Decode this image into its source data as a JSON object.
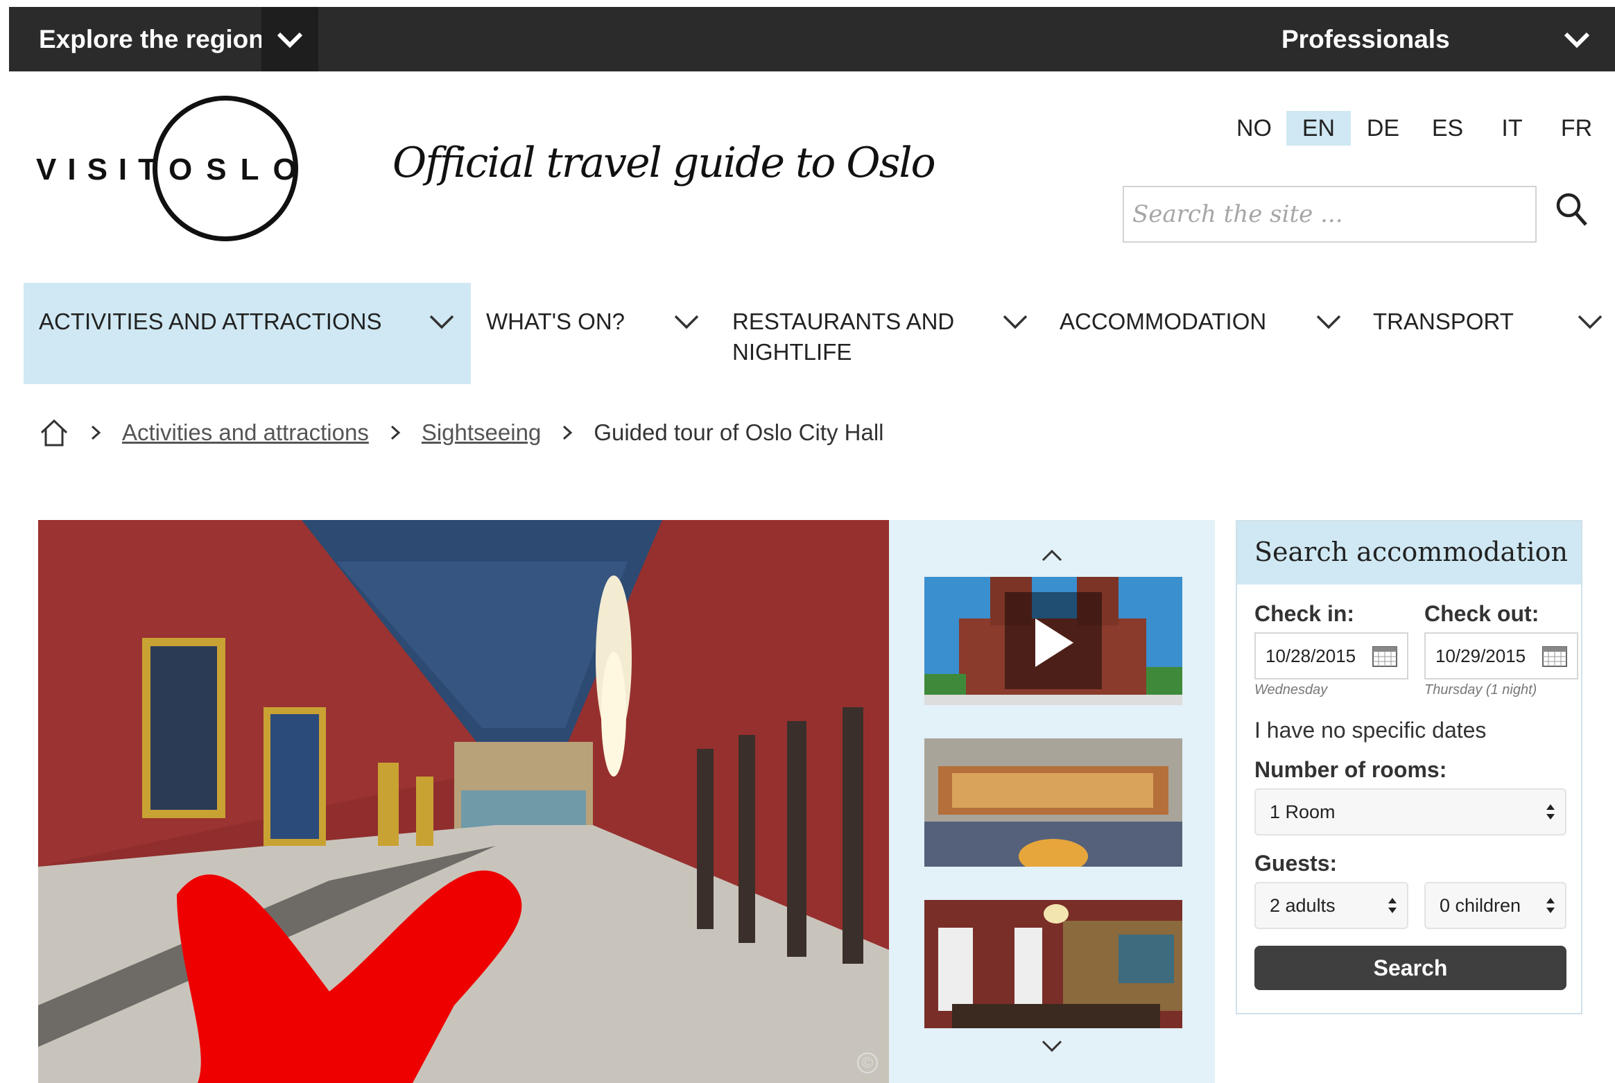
{
  "topbar": {
    "explore_label": "Explore the region",
    "professionals_label": "Professionals"
  },
  "header": {
    "logo_visit": "VISIT",
    "logo_oslo": "OSLO",
    "tagline": "Official travel guide to Oslo",
    "languages": [
      "NO",
      "EN",
      "DE",
      "ES",
      "IT",
      "FR"
    ],
    "active_language": "EN",
    "search_placeholder": "Search the site ..."
  },
  "nav": {
    "items": [
      {
        "label": "ACTIVITIES AND ATTRACTIONS",
        "active": true
      },
      {
        "label": "WHAT'S ON?",
        "active": false
      },
      {
        "label": "RESTAURANTS AND NIGHTLIFE",
        "active": false
      },
      {
        "label": "ACCOMMODATION",
        "active": false
      },
      {
        "label": "TRANSPORT",
        "active": false
      }
    ]
  },
  "breadcrumb": {
    "items": [
      "Activities and attractions",
      "Sightseeing"
    ],
    "current": "Guided tour of Oslo City Hall"
  },
  "gallery": {
    "copyright_symbol": "©"
  },
  "accommodation": {
    "title": "Search accommodation",
    "checkin_label": "Check in:",
    "checkout_label": "Check out:",
    "checkin_value": "10/28/2015",
    "checkout_value": "10/29/2015",
    "checkin_day": "Wednesday",
    "checkout_day": "Thursday (1 night)",
    "no_dates": "I have no specific dates",
    "rooms_label": "Number of rooms:",
    "rooms_value": "1 Room",
    "guests_label": "Guests:",
    "adults_value": "2 adults",
    "children_value": "0 children",
    "search_button": "Search"
  },
  "colors": {
    "topbar": "#2b2b2b",
    "nav_active": "#cfe8f3",
    "thumb_bg": "#e3f1f8",
    "search_button": "#3f3f3f"
  }
}
